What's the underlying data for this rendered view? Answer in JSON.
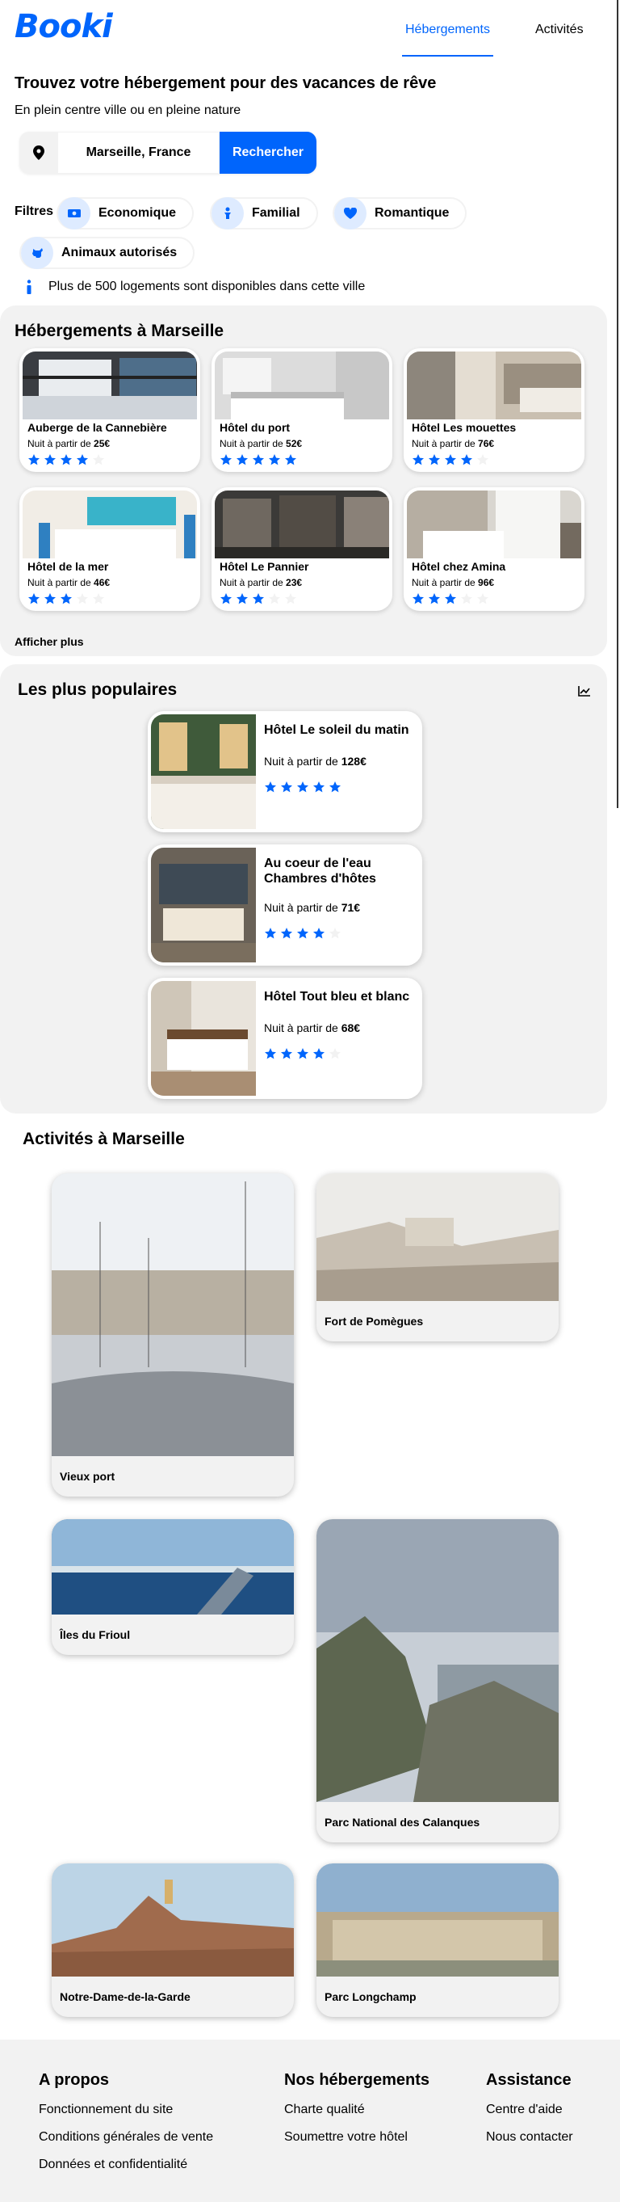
{
  "header": {
    "logo": "Booki",
    "nav": [
      "Hébergements",
      "Activités"
    ]
  },
  "hero": {
    "title": "Trouvez votre hébergement pour des vacances de rêve",
    "subtitle": "En plein centre ville ou en pleine nature",
    "search_value": "Marseille, France",
    "search_button": "Rechercher"
  },
  "filters": {
    "label": "Filtres",
    "chips": [
      "Economique",
      "Familial",
      "Romantique",
      "Animaux autorisés"
    ],
    "info": "Plus de 500 logements sont disponibles dans cette ville"
  },
  "hebergements": {
    "title": "Hébergements à Marseille",
    "price_prefix": "Nuit à partir de",
    "items": [
      {
        "name": "Auberge de la Cannebière",
        "price": "25€",
        "rating": 4
      },
      {
        "name": "Hôtel du port",
        "price": "52€",
        "rating": 5
      },
      {
        "name": "Hôtel Les mouettes",
        "price": "76€",
        "rating": 4
      },
      {
        "name": "Hôtel de la mer",
        "price": "46€",
        "rating": 3
      },
      {
        "name": "Hôtel Le Pannier",
        "price": "23€",
        "rating": 3
      },
      {
        "name": "Hôtel chez Amina",
        "price": "96€",
        "rating": 3
      }
    ],
    "show_more": "Afficher plus"
  },
  "populaires": {
    "title": "Les plus populaires",
    "items": [
      {
        "name": "Hôtel Le soleil du matin",
        "price": "128€",
        "rating": 5
      },
      {
        "name": "Au coeur de l'eau Chambres d'hôtes",
        "price": "71€",
        "rating": 4
      },
      {
        "name": "Hôtel Tout bleu et blanc",
        "price": "68€",
        "rating": 4
      }
    ]
  },
  "activites": {
    "title": "Activités à Marseille",
    "items": [
      "Vieux port",
      "Fort de Pomègues",
      "Îles du Frioul",
      "Parc National des Calanques",
      "Notre-Dame-de-la-Garde",
      "Parc Longchamp"
    ]
  },
  "footer": {
    "col1": {
      "title": "A propos",
      "links": [
        "Fonctionnement du site",
        "Conditions générales de vente",
        "Données et confidentialité"
      ]
    },
    "col2": {
      "title": "Nos hébergements",
      "links": [
        "Charte qualité",
        "Soumettre votre hôtel"
      ]
    },
    "col3": {
      "title": "Assistance",
      "links": [
        "Centre d'aide",
        "Nous contacter"
      ]
    }
  },
  "colors": {
    "accent": "#0065fc",
    "grey_bg": "#f2f2f2",
    "chip_icon_bg": "#deebff",
    "star_off": "#f2f2f2"
  }
}
